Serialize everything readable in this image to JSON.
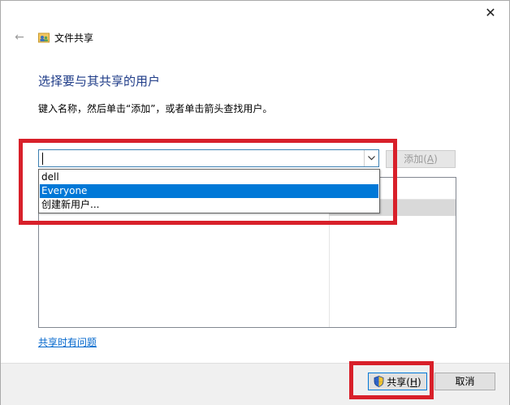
{
  "window": {
    "close_glyph": "✕",
    "back_glyph": "←"
  },
  "header": {
    "title": "文件共享",
    "title_icon": "users-folder-icon"
  },
  "main": {
    "heading": "选择要与其共享的用户",
    "instruction": "键入名称，然后单击“添加”，或者单击箭头查找用户。",
    "name_input": {
      "value": ""
    },
    "add_button": {
      "label_prefix": "添加(",
      "accel": "A",
      "label_suffix": ")"
    },
    "dropdown_items": [
      "dell",
      "Everyone",
      "创建新用户..."
    ],
    "selected_index": 1,
    "help_link": "共享时有问题"
  },
  "footer": {
    "share_button": {
      "label_prefix": "共享(",
      "accel": "H",
      "label_suffix": ")",
      "icon": "uac-shield-icon"
    },
    "cancel_button": "取消"
  },
  "colors": {
    "accent": "#0078d7",
    "highlight": "#d8202a",
    "heading": "#1f3c88",
    "link": "#0066cc"
  }
}
